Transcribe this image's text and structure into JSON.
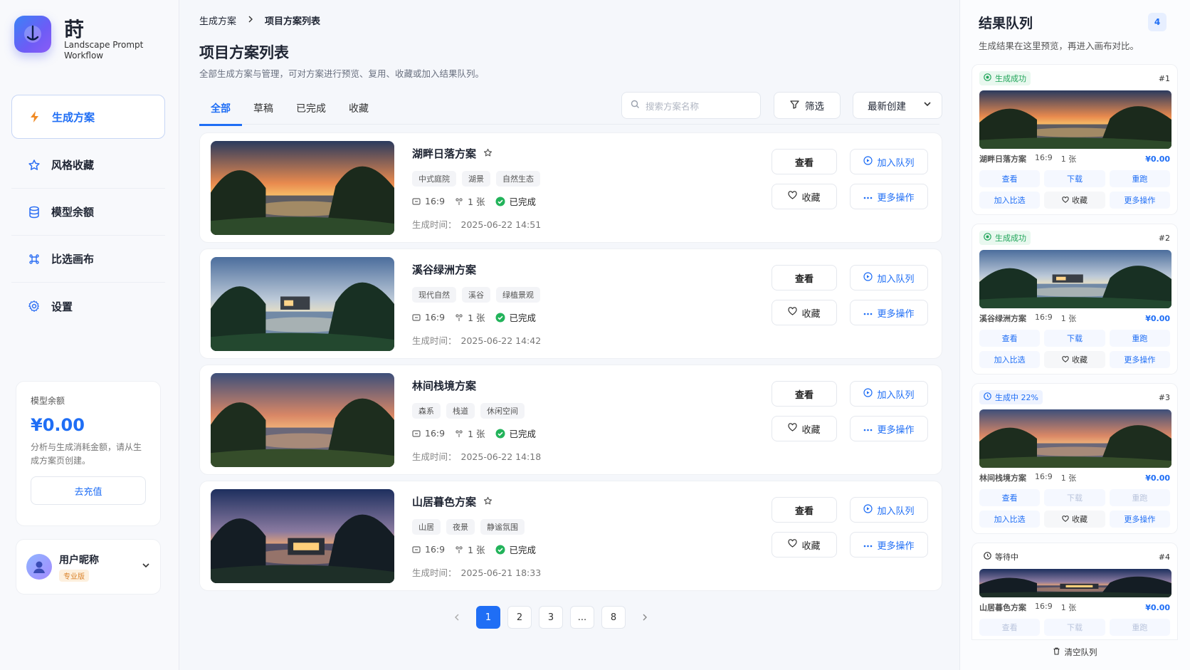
{
  "brand": {
    "title": "莳",
    "subtitle": "Landscape Prompt Workflow"
  },
  "sidebar": {
    "items": [
      {
        "label": "生成方案",
        "icon": "bolt-icon",
        "active": true
      },
      {
        "label": "风格收藏",
        "icon": "star-icon"
      },
      {
        "label": "模型余额",
        "icon": "database-icon"
      },
      {
        "label": "比选画布",
        "icon": "command-icon"
      },
      {
        "label": "设置",
        "icon": "gear-icon"
      }
    ],
    "balance": {
      "label": "模型余额",
      "amount": "¥0.00",
      "desc": "分析与生成消耗金额，请从生成方案页创建。",
      "button": "去充值"
    },
    "user": {
      "name": "用户昵称",
      "badge": "专业版"
    }
  },
  "header": {
    "breadcrumb": [
      "生成方案",
      "项目方案列表"
    ],
    "title": "项目方案列表",
    "desc": "全部生成方案与管理，可对方案进行预览、复用、收藏或加入结果队列。"
  },
  "tabs": [
    "全部",
    "草稿",
    "已完成",
    "收藏"
  ],
  "toolbar": {
    "search_placeholder": "搜索方案名称",
    "filter": "筛选",
    "sort": "最新创建"
  },
  "labels": {
    "view": "查看",
    "fav": "收藏",
    "queue": "加入队列",
    "more": "更多操作",
    "time_label": "生成时间："
  },
  "projects": [
    {
      "name": "湖畔日落方案",
      "star": true,
      "tags": [
        "中式庭院",
        "湖景",
        "自然生态"
      ],
      "ratio": "16:9",
      "count": "1 张",
      "status": "已完成",
      "time": "2025-06-22 14:51"
    },
    {
      "name": "溪谷绿洲方案",
      "star": false,
      "tags": [
        "现代自然",
        "溪谷",
        "绿植景观"
      ],
      "ratio": "16:9",
      "count": "1 张",
      "status": "已完成",
      "time": "2025-06-22 14:42"
    },
    {
      "name": "林间栈境方案",
      "star": false,
      "tags": [
        "森系",
        "栈道",
        "休闲空间"
      ],
      "ratio": "16:9",
      "count": "1 张",
      "status": "已完成",
      "time": "2025-06-22 14:18"
    },
    {
      "name": "山居暮色方案",
      "star": true,
      "tags": [
        "山居",
        "夜景",
        "静谧氛围"
      ],
      "ratio": "16:9",
      "count": "1 张",
      "status": "已完成",
      "time": "2025-06-21 18:33"
    }
  ],
  "pagination": {
    "pages": [
      "1",
      "2",
      "3",
      "...",
      "8"
    ],
    "current": "1"
  },
  "queue": {
    "title": "结果队列",
    "count": "4",
    "subtitle": "生成结果在这里预览，再进入画布对比。",
    "items": [
      {
        "status": "生成成功",
        "kind": "success",
        "num": "#1",
        "name": "湖畔日落方案",
        "ratio": "16:9",
        "count": "1 张",
        "price": "¥0.00"
      },
      {
        "status": "生成成功",
        "kind": "success",
        "num": "#2",
        "name": "溪谷绿洲方案",
        "ratio": "16:9",
        "count": "1 张",
        "price": "¥0.00"
      },
      {
        "status": "生成中 22%",
        "kind": "progress",
        "num": "#3",
        "name": "林间栈境方案",
        "ratio": "16:9",
        "count": "1 张",
        "price": "¥0.00"
      },
      {
        "status": "等待中",
        "kind": "wait",
        "num": "#4",
        "name": "山居暮色方案",
        "ratio": "16:9",
        "count": "1 张",
        "price": "¥0.00"
      }
    ],
    "btns": {
      "view": "查看",
      "download": "下载",
      "rerun": "重跑",
      "compare": "加入比选",
      "fav": "收藏",
      "more": "更多操作"
    },
    "clear": "清空队列"
  }
}
